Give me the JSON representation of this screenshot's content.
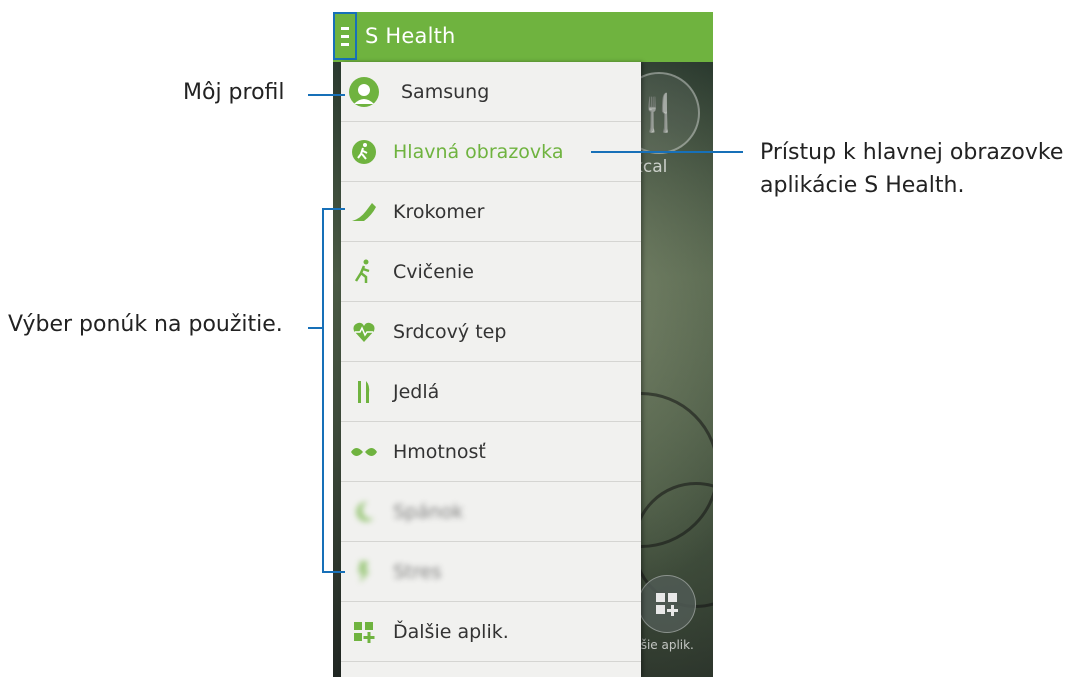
{
  "header": {
    "title": "S Health"
  },
  "drawer": {
    "items": [
      {
        "label": "Samsung",
        "icon": "profile-avatar-icon"
      },
      {
        "label": "Hlavná obrazovka",
        "icon": "home-runner-icon"
      },
      {
        "label": "Krokomer",
        "icon": "shoe-icon"
      },
      {
        "label": "Cvičenie",
        "icon": "runner-icon"
      },
      {
        "label": "Srdcový tep",
        "icon": "heart-rate-icon"
      },
      {
        "label": "Jedlá",
        "icon": "fork-knife-icon"
      },
      {
        "label": "Hmotnosť",
        "icon": "scale-icon"
      },
      {
        "label": "Spánok",
        "icon": "sleep-moon-icon"
      },
      {
        "label": "Stres",
        "icon": "stress-icon"
      },
      {
        "label": "Ďalšie aplik.",
        "icon": "more-apps-icon"
      }
    ]
  },
  "background": {
    "kcal": "kcal",
    "more_apps": "alšie aplik."
  },
  "annotations": {
    "profile": "Môj profil",
    "home": "Prístup k hlavnej obrazovke aplikácie S Health.",
    "home_line1": "Prístup k hlavnej obrazovke",
    "home_line2": "aplikácie S Health.",
    "menus": "Výber ponúk na použitie."
  },
  "colors": {
    "accent": "#6fb33f",
    "callout": "#1770b8",
    "drawer_bg": "#f1f1ef"
  }
}
